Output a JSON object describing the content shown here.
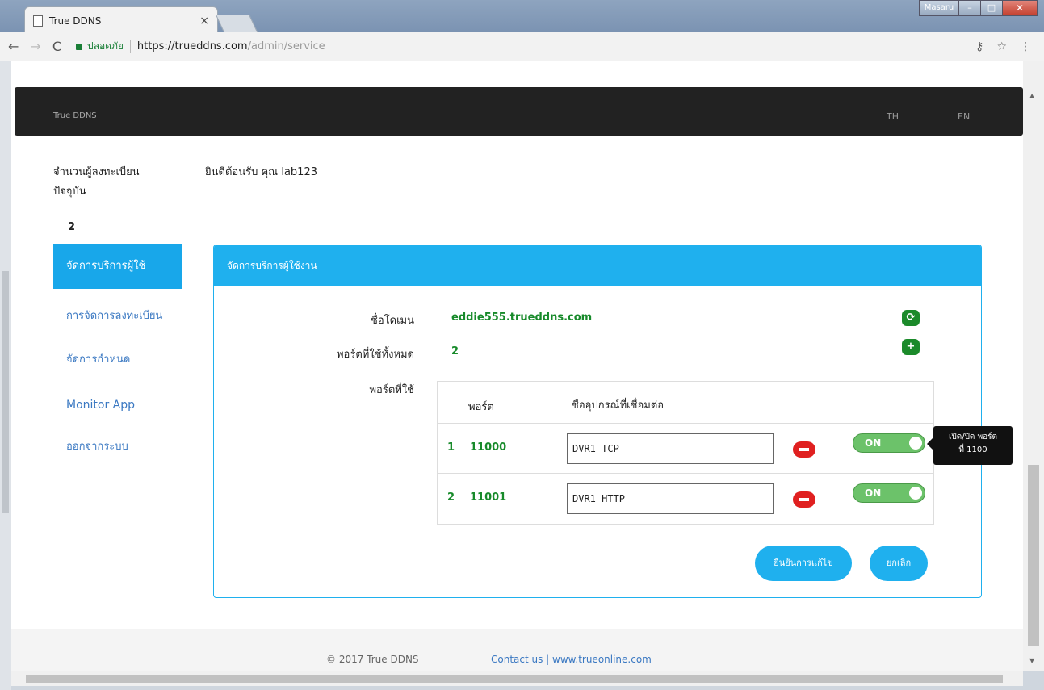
{
  "browser": {
    "tab_title": "True DDNS",
    "tab_close": "×",
    "profile_name": "Masaru",
    "min": "–",
    "max": "□",
    "close": "✕",
    "secure_label": "ปลอดภัย",
    "url_host": "https://trueddns.com",
    "url_path": "/admin/service",
    "back": "←",
    "forward": "→",
    "reload": "C",
    "key_icon": "⚷",
    "star_icon": "☆",
    "menu_icon": "⋮"
  },
  "navbar": {
    "brand": "True DDNS",
    "lang_th": "TH",
    "lang_en": "EN"
  },
  "sidebar": {
    "reg_label": "จำนวนผู้ลงทะเบียน ปัจจุบัน",
    "reg_count": "2",
    "items": [
      {
        "label": "จัดการบริการผู้ใช้"
      },
      {
        "label": "การจัดการลงทะเบียน"
      },
      {
        "label": "จัดการกำหนด"
      },
      {
        "label": "Monitor App"
      },
      {
        "label": "ออกจากระบบ"
      }
    ]
  },
  "welcome": "ยินดีต้อนรับ คุณ lab123",
  "panel": {
    "title": "จัดการบริการผู้ใช้งาน",
    "domain_label": "ชื่อโดเมน",
    "domain_value": "eddie555.trueddns.com",
    "ports_total_label": "พอร์ตที่ใช้ทั้งหมด",
    "ports_total_value": "2",
    "ports_used_label": "พอร์ตที่ใช้",
    "refresh_icon": "⟳",
    "add_icon": "+",
    "table": {
      "col_port": "พอร์ต",
      "col_device": "ชื่ออุปกรณ์ที่เชื่อมต่อ",
      "rows": [
        {
          "idx": "1",
          "port": "11000",
          "device": "DVR1 TCP",
          "toggle": "ON"
        },
        {
          "idx": "2",
          "port": "11001",
          "device": "DVR1 HTTP",
          "toggle": "ON"
        }
      ]
    },
    "tooltip_line1": "เปิด/ปิด พอร์ต",
    "tooltip_line2": "ที่ 1100",
    "confirm_button": "ยืนยันการแก้ไข",
    "cancel_button": "ยกเลิก"
  },
  "footer": {
    "copyright": "© 2017 True DDNS",
    "contact": "Contact us | www.trueonline.com"
  },
  "colors": {
    "accent": "#1fb0ee",
    "green": "#178a2a",
    "danger": "#e02020",
    "navbar": "#222222"
  }
}
